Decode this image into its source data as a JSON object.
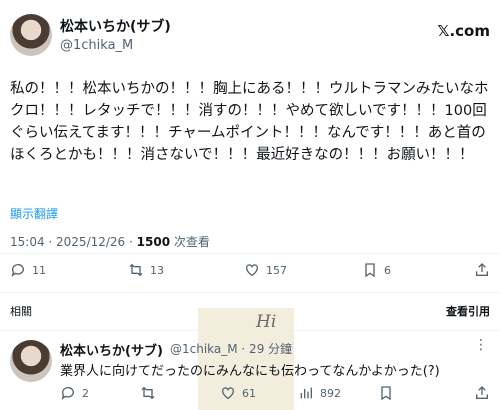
{
  "tweet": {
    "author_name": "松本いちか(サブ)",
    "author_handle": "@1chika_M",
    "brand": "𝕏.com",
    "text": "私の！！！松本いちかの！！！胸上にある！！！ウルトラマンみたいなホクロ！！！レタッチで！！！消すの！！！やめて欲しいです！！！100回ぐらい伝えてます！！！チャームポイント！！！なんです！！！あと首のほくろとかも！！！消さないで！！！最近好きなの！！！お願い！！！",
    "translate_label": "顯示翻譯",
    "time": "15:04 · 2025/12/26 · ",
    "views_count": "1500",
    "views_label": " 次查看",
    "replies": "11",
    "retweets": "13",
    "likes": "157",
    "bookmarks": "6"
  },
  "section": {
    "related_label": "相關",
    "more_replies_label": "查看引用"
  },
  "reply": {
    "author_name": "松本いちか(サブ)",
    "author_handle": "@1chika_M · 29 分鐘",
    "more": "⋮",
    "text": "業界人に向けてだったのにみんなにも伝わってなんかよかった(?)",
    "replies": "2",
    "likes": "61",
    "views": "892"
  },
  "sticker": {
    "text": "Hi"
  },
  "icons": {
    "reply": "reply-icon",
    "retweet": "retweet-icon",
    "like": "heart-icon",
    "bookmark": "bookmark-icon",
    "share": "share-icon",
    "views": "views-icon"
  },
  "colors": {
    "accent": "#1d9bf0",
    "muted": "#536471",
    "text": "#0f1419"
  }
}
